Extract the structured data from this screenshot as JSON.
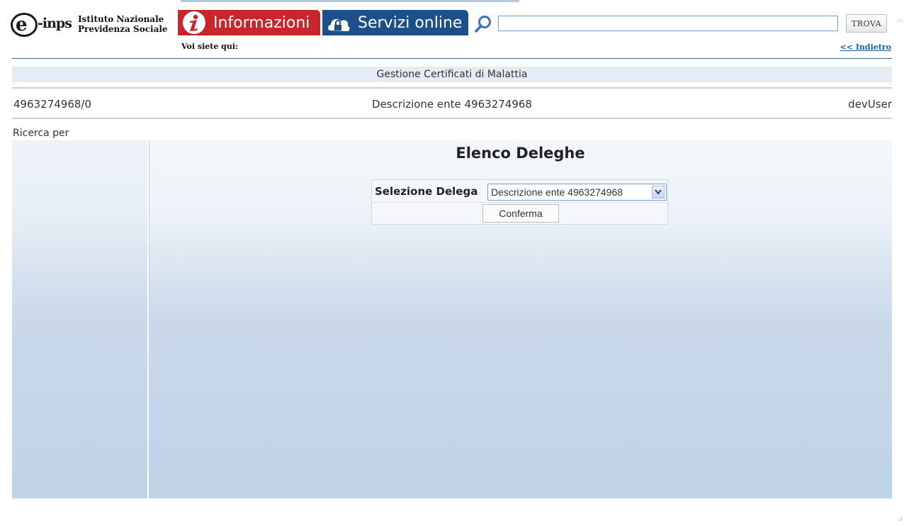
{
  "header": {
    "logo_text": "e-inps",
    "logo_e": "e",
    "logo_inps": "-inps",
    "institute_line1": "Istituto Nazionale",
    "institute_line2": "Previdenza Sociale",
    "tab_info_label": "Informazioni",
    "tab_servizi_label": "Servizi online",
    "search_value": "",
    "search_button_label": "TROVA",
    "breadcrumb_label": "Voi siete qui:",
    "back_link_label": "<< Indietro"
  },
  "page": {
    "section_title": "Gestione Certificati di Malattia",
    "ente_code": "4963274968/0",
    "ente_description": "Descrizione ente 4963274968",
    "user": "devUser",
    "search_by_label": "Ricerca per"
  },
  "main": {
    "title": "Elenco Deleghe",
    "select_label": "Selezione Delega",
    "select_value": "Descrizione ente 4963274968",
    "confirm_button_label": "Conferma"
  },
  "colors": {
    "info_tab": "#c8252d",
    "servizi_tab": "#1d4f8a",
    "link": "#1a5fa8",
    "panel_gradient_bottom": "#bfd3e8"
  },
  "icons": {
    "info": "info-icon",
    "servizi": "cloud-lock-icon",
    "search": "search-icon",
    "dropdown": "chevron-down-icon"
  }
}
